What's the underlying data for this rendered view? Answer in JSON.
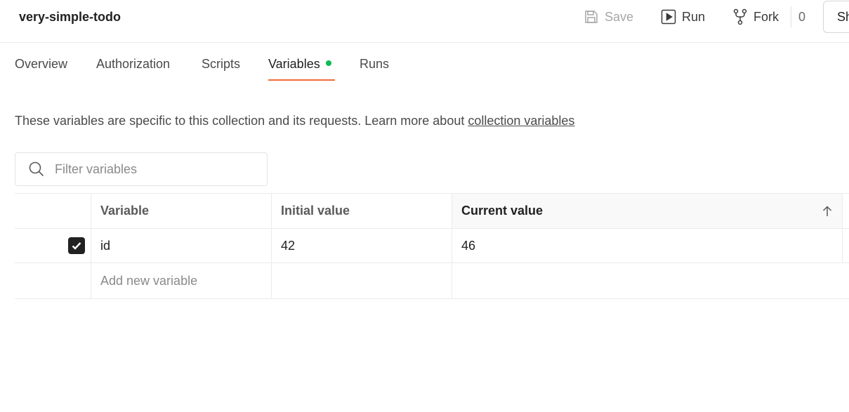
{
  "header": {
    "title": "very-simple-todo",
    "save_label": "Save",
    "run_label": "Run",
    "fork_label": "Fork",
    "fork_count": "0",
    "share_label": "Sh"
  },
  "tabs": [
    {
      "label": "Overview"
    },
    {
      "label": "Authorization"
    },
    {
      "label": "Scripts"
    },
    {
      "label": "Variables"
    },
    {
      "label": "Runs"
    }
  ],
  "active_tab": "Variables",
  "description": {
    "text": "These variables are specific to this collection and its requests. Learn more about ",
    "link": "collection variables"
  },
  "filter": {
    "placeholder": "Filter variables",
    "value": ""
  },
  "table": {
    "columns": [
      "Variable",
      "Initial value",
      "Current value"
    ],
    "rows": [
      {
        "enabled": true,
        "variable": "id",
        "initial_value": "42",
        "current_value": "46"
      }
    ],
    "add_placeholder": "Add new variable"
  },
  "colors": {
    "accent": "#f26b3a",
    "dot": "#0cbb52",
    "checkbox": "#212121"
  }
}
